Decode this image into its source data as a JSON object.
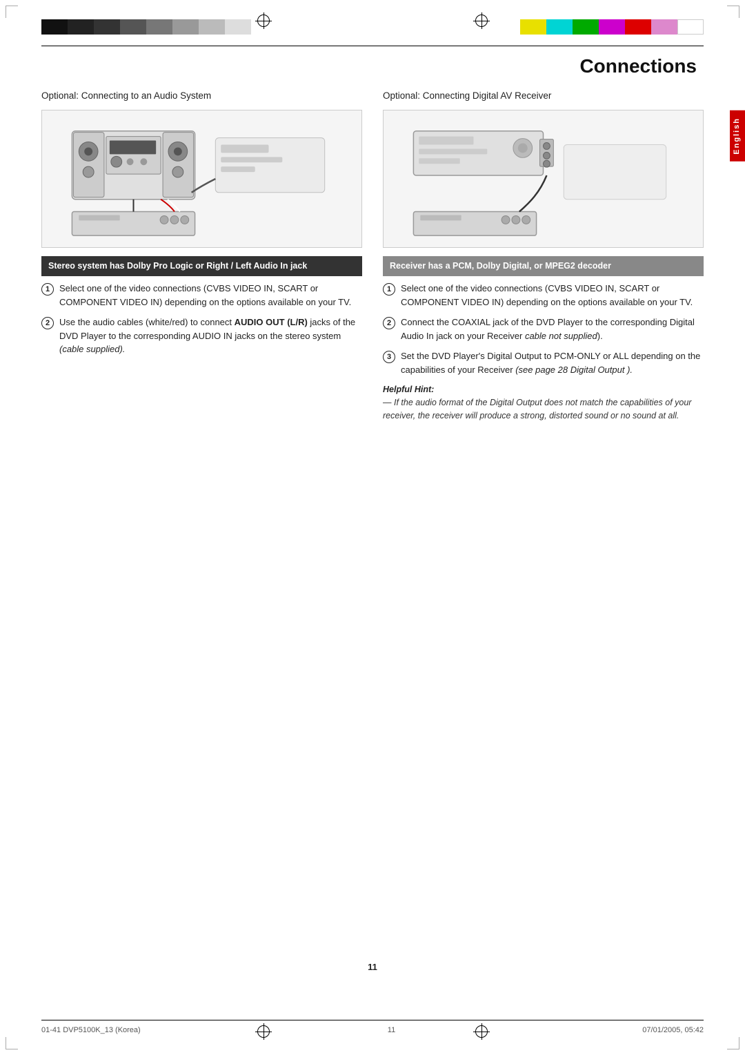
{
  "page": {
    "title": "Connections",
    "page_number": "11",
    "language_tab": "English"
  },
  "footer": {
    "left": "01-41 DVP5100K_13 (Korea)",
    "center": "11",
    "right": "07/01/2005, 05:42"
  },
  "color_bars_left": [
    "black",
    "black",
    "black",
    "black",
    "black",
    "black",
    "white",
    "white",
    "lightgray",
    "gray"
  ],
  "color_bars_right": [
    "yellow",
    "cyan",
    "green",
    "magenta",
    "red",
    "pink",
    "white"
  ],
  "left_section": {
    "title": "Optional: Connecting to an Audio System",
    "instruction_header": "Stereo system has Dolby Pro Logic or Right / Left Audio In jack",
    "steps": [
      {
        "number": "1",
        "text": "Select one of the video connections (CVBS VIDEO IN, SCART or COMPONENT VIDEO IN) depending on the options available on your TV."
      },
      {
        "number": "2",
        "text_parts": [
          {
            "text": "Use the audio cables (white/red) to connect ",
            "bold": false
          },
          {
            "text": "AUDIO OUT (L/R)",
            "bold": true
          },
          {
            "text": " jacks of the DVD Player to the corresponding AUDIO IN jacks on the stereo system ",
            "bold": false
          },
          {
            "text": "(cable supplied).",
            "bold": false,
            "italic": true
          }
        ]
      }
    ]
  },
  "right_section": {
    "title": "Optional: Connecting Digital AV Receiver",
    "instruction_header": "Receiver has a PCM, Dolby Digital, or MPEG2 decoder",
    "steps": [
      {
        "number": "1",
        "text": "Select one of the video connections (CVBS VIDEO IN, SCART or COMPONENT VIDEO IN) depending on the options available on your TV."
      },
      {
        "number": "2",
        "text_parts": [
          {
            "text": "Connect the COAXIAL jack of the DVD Player to the corresponding Digital Audio In jack on your Receiver ",
            "bold": false
          },
          {
            "text": "cable not supplied",
            "bold": false,
            "italic": true
          },
          {
            "text": ").",
            "bold": false
          }
        ]
      },
      {
        "number": "3",
        "text_parts": [
          {
            "text": "Set the DVD Player's Digital Output to PCM-ONLY or ALL depending on the capabilities of your Receiver ",
            "bold": false
          },
          {
            "text": "(see page 28 Digital Output ).",
            "bold": false,
            "italic": true
          }
        ]
      }
    ],
    "helpful_hint": {
      "title": "Helpful Hint:",
      "text": "— If the audio format of the Digital Output does not match the capabilities of your receiver, the receiver will produce a strong, distorted sound or no sound at all."
    }
  }
}
